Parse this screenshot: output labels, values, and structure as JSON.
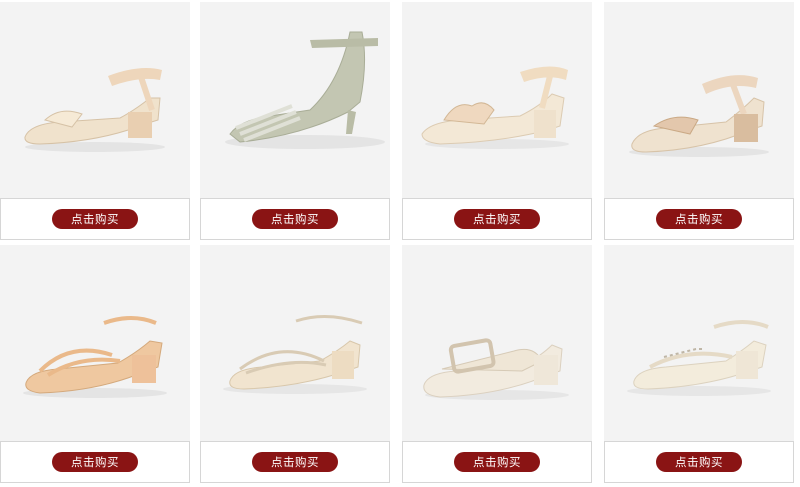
{
  "products": [
    {
      "buy_label": "点击购买",
      "image": "sandal-image",
      "color": "#efdcc4"
    },
    {
      "buy_label": "点击购买",
      "image": "heel-image",
      "color": "#c9ccb9"
    },
    {
      "buy_label": "点击购买",
      "image": "sandal-image",
      "color": "#f2e6d3"
    },
    {
      "buy_label": "点击购买",
      "image": "sandal-image",
      "color": "#e8ceb3"
    },
    {
      "buy_label": "点击购买",
      "image": "sandal-image",
      "color": "#efc9a3"
    },
    {
      "buy_label": "点击购买",
      "image": "sandal-image",
      "color": "#efe2cc"
    },
    {
      "buy_label": "点击购买",
      "image": "slide-image",
      "color": "#f0e8da"
    },
    {
      "buy_label": "点击购买",
      "image": "sandal-image",
      "color": "#f1ead8"
    }
  ],
  "colors": {
    "button": "#8a1414",
    "image_bg": "#f3f3f3",
    "border": "#d6d6d6"
  }
}
